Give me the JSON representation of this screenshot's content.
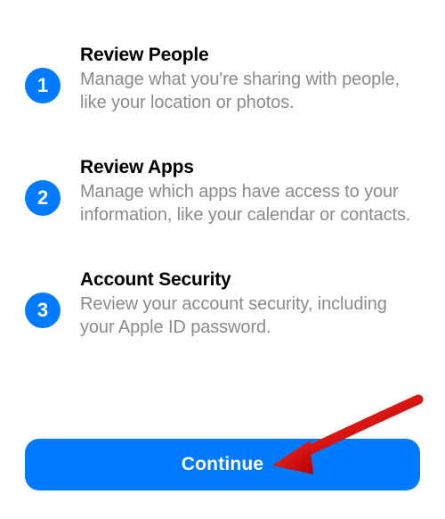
{
  "steps": [
    {
      "number": "1",
      "title": "Review People",
      "description": "Manage what you're sharing with people, like your location or photos."
    },
    {
      "number": "2",
      "title": "Review Apps",
      "description": "Manage which apps have access to your information, like your calendar or contacts."
    },
    {
      "number": "3",
      "title": "Account Security",
      "description": "Review your account security, including your Apple ID password."
    }
  ],
  "continue_label": "Continue",
  "colors": {
    "accent": "#007aff",
    "text_secondary": "#8a8a8e",
    "arrow": "#d30d13"
  }
}
